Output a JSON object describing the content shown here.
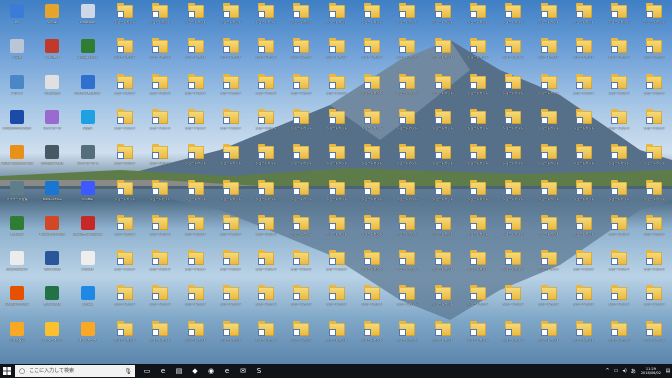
{
  "desktop": {
    "app_icons": [
      {
        "label": "PC",
        "color": "#3c7bd6",
        "glyph": "pc-icon"
      },
      {
        "label": "Virtual",
        "color": "#e5a42c",
        "glyph": "app-icon"
      },
      {
        "label": "WORDPAD",
        "color": "#cfd8e6",
        "glyph": "app-icon"
      },
      {
        "label": "ごみ箱",
        "color": "#b8c6d6",
        "glyph": "recycle-bin-icon"
      },
      {
        "label": "ACROBAT",
        "color": "#c0392b",
        "glyph": "app-icon"
      },
      {
        "label": "Google Drive",
        "color": "#2e7d32",
        "glyph": "app-icon"
      },
      {
        "label": "ドライブ",
        "color": "#4a86c8",
        "glyph": "app-icon"
      },
      {
        "label": "AdobeCS6",
        "color": "#e0e0e0",
        "glyph": "app-icon"
      },
      {
        "label": "Internet Explorer",
        "color": "#2f6fcf",
        "glyph": "app-icon"
      },
      {
        "label": "LineCommunicator",
        "color": "#1b4aa8",
        "glyph": "app-icon"
      },
      {
        "label": "ネットワーク",
        "color": "#9a6bcf",
        "glyph": "app-icon"
      },
      {
        "label": "Skype",
        "color": "#1fa0e0",
        "glyph": "app-icon"
      },
      {
        "label": "Adobe Illustrator CS6",
        "color": "#e8901a",
        "glyph": "illustrator-icon"
      },
      {
        "label": "Configure BLTL",
        "color": "#455a64",
        "glyph": "app-icon"
      },
      {
        "label": "ネットワーク 3",
        "color": "#546e7a",
        "glyph": "app-icon"
      },
      {
        "label": "パスワード管理",
        "color": "#607d8b",
        "glyph": "app-icon"
      },
      {
        "label": "BizWorkFlow",
        "color": "#1976d2",
        "glyph": "app-icon"
      },
      {
        "label": "CmdBar",
        "color": "#3d5afe",
        "glyph": "app-icon"
      },
      {
        "label": "EndNote",
        "color": "#2e7d32",
        "glyph": "app-icon"
      },
      {
        "label": "PowerPoint 2016",
        "color": "#d24726",
        "glyph": "powerpoint-icon"
      },
      {
        "label": "LibreOffice Impress",
        "color": "#c62828",
        "glyph": "app-icon"
      },
      {
        "label": "Dreamweaver",
        "color": "#ececec",
        "glyph": "app-icon"
      },
      {
        "label": "Word 2016",
        "color": "#2b579a",
        "glyph": "word-icon"
      },
      {
        "label": "Picasa3",
        "color": "#eeeeee",
        "glyph": "app-icon"
      },
      {
        "label": "Google Chrome",
        "color": "#e65100",
        "glyph": "app-icon"
      },
      {
        "label": "Excel 2016",
        "color": "#217346",
        "glyph": "excel-icon"
      },
      {
        "label": "Access",
        "color": "#1e88e5",
        "glyph": "app-icon"
      },
      {
        "label": "アプリ設定",
        "color": "#f9a825",
        "glyph": "app-icon"
      },
      {
        "label": "インターネット",
        "color": "#fbc02d",
        "glyph": "app-icon"
      },
      {
        "label": "ネットワーク",
        "color": "#f9a825",
        "glyph": "app-icon"
      },
      {
        "label": "リモートデスクトップ",
        "color": "#1565c0",
        "glyph": "app-icon"
      },
      {
        "label": "UNISTATIONS",
        "color": "#7cb342",
        "glyph": "app-icon"
      },
      {
        "label": "LAPLINK",
        "color": "#1e88e5",
        "glyph": "app-icon"
      },
      {
        "label": "テキスト",
        "color": "#43a047",
        "glyph": "app-icon"
      }
    ],
    "folder_label": "ショートカット",
    "folder_rows": 10,
    "folder_cols": 16
  },
  "taskbar": {
    "search_placeholder": "ここに入力して検索",
    "apps": [
      {
        "name": "task-view",
        "glyph": "▭"
      },
      {
        "name": "edge",
        "glyph": "e"
      },
      {
        "name": "file-explorer",
        "glyph": "▤"
      },
      {
        "name": "store",
        "glyph": "◆"
      },
      {
        "name": "chrome",
        "glyph": "◉"
      },
      {
        "name": "ie",
        "glyph": "e"
      },
      {
        "name": "outlook",
        "glyph": "✉"
      },
      {
        "name": "skype",
        "glyph": "S"
      }
    ],
    "time": "11:29",
    "date": "2018/06/02"
  }
}
